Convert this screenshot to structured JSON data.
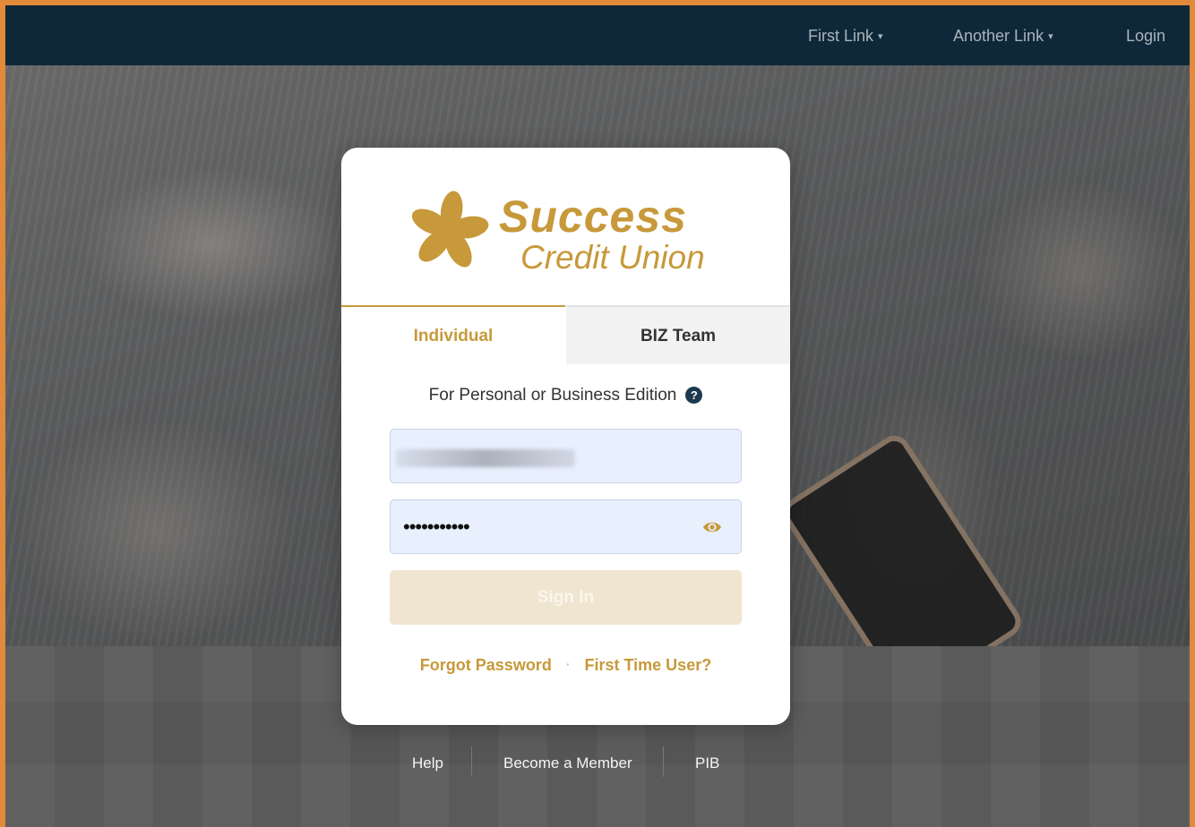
{
  "nav": {
    "items": [
      {
        "label": "First Link",
        "has_dropdown": true
      },
      {
        "label": "Another Link",
        "has_dropdown": true
      },
      {
        "label": "Login",
        "has_dropdown": false
      }
    ],
    "caret": "▾"
  },
  "brand": {
    "name": "Success",
    "subtitle": "Credit Union",
    "logo_icon": "flower-pinwheel-icon",
    "color": "#c7993a"
  },
  "login": {
    "tabs": [
      {
        "label": "Individual",
        "active": true
      },
      {
        "label": "BIZ Team",
        "active": false
      }
    ],
    "edition_text": "For Personal or Business Edition",
    "help_icon": "?",
    "username": {
      "value": "",
      "obscured": true
    },
    "password": {
      "value": "•••••••••••",
      "icon": "eye-icon"
    },
    "sign_in_label": "Sign In",
    "forgot_password": "Forgot Password",
    "separator": "·",
    "first_time_user": "First Time User?"
  },
  "footer": {
    "links": [
      "Help",
      "Become a Member",
      "PIB"
    ]
  },
  "colors": {
    "nav_bg": "#0f2839",
    "accent_gold": "#c7993a",
    "input_bg": "#e8effd",
    "button_disabled": "#f0e5d0"
  }
}
